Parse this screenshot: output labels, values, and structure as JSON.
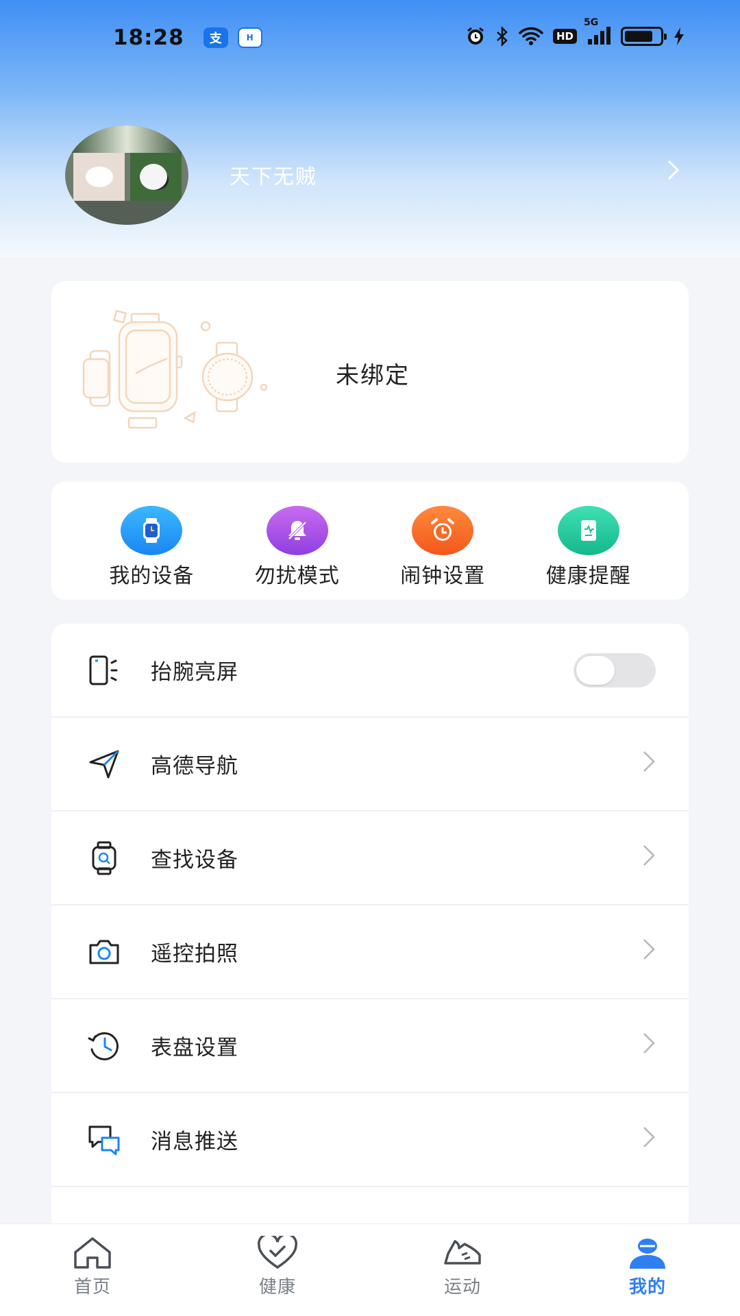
{
  "status_bar": {
    "time": "18:28",
    "apps": [
      {
        "name": "alipay-icon",
        "glyph": "支"
      },
      {
        "name": "homie-icon",
        "glyph": "H"
      }
    ],
    "network_badge": "HD",
    "signal_label": "5G"
  },
  "profile": {
    "username": "天下无贼"
  },
  "device": {
    "status": "未绑定"
  },
  "quick_actions": [
    {
      "label": "我的设备",
      "icon": "watch-icon",
      "color": "#1a86f2"
    },
    {
      "label": "勿扰模式",
      "icon": "bell-off-icon",
      "color": "#8f3ee0"
    },
    {
      "label": "闹钟设置",
      "icon": "alarm-clock-icon",
      "color": "#f2571b"
    },
    {
      "label": "健康提醒",
      "icon": "health-report-icon",
      "color": "#14b88b"
    }
  ],
  "settings": {
    "rows": [
      {
        "label": "抬腕亮屏",
        "icon": "raise-wrist-icon",
        "type": "toggle",
        "on": false
      },
      {
        "label": "高德导航",
        "icon": "navigation-arrow-icon",
        "type": "link"
      },
      {
        "label": "查找设备",
        "icon": "find-watch-icon",
        "type": "link"
      },
      {
        "label": "遥控拍照",
        "icon": "camera-icon",
        "type": "link"
      },
      {
        "label": "表盘设置",
        "icon": "watch-face-history-icon",
        "type": "link"
      },
      {
        "label": "消息推送",
        "icon": "message-bubbles-icon",
        "type": "link"
      }
    ]
  },
  "bottom_nav": {
    "active": "我的",
    "items": [
      {
        "label": "首页",
        "icon": "home-icon"
      },
      {
        "label": "健康",
        "icon": "heart-check-icon"
      },
      {
        "label": "运动",
        "icon": "sneaker-icon"
      },
      {
        "label": "我的",
        "icon": "user-icon"
      }
    ]
  },
  "colors": {
    "accent": "#2f7ff0",
    "header_gradient_top": "#3f8ff5",
    "page_bg": "#f3f5f9"
  }
}
